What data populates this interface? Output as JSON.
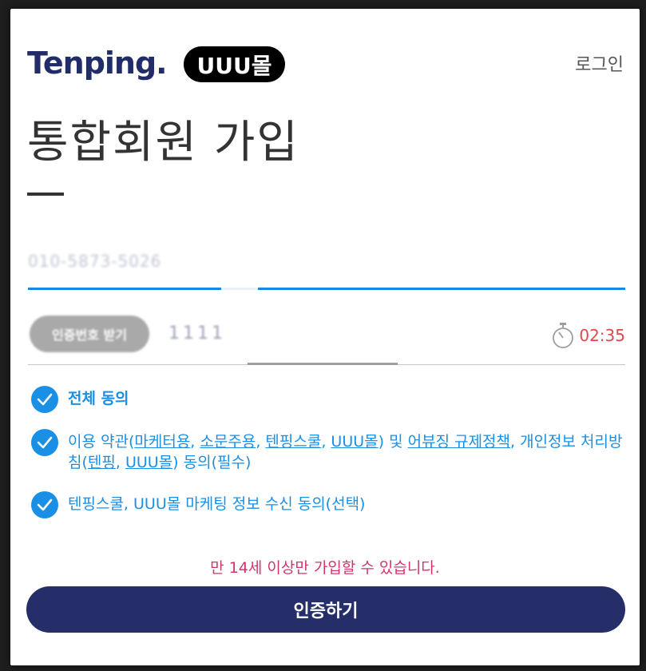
{
  "header": {
    "brand": "Tenping.",
    "mall_badge": "UUU몰",
    "login": "로그인"
  },
  "page": {
    "title": "통합회원 가입"
  },
  "phone": {
    "value": "010-5873-5026"
  },
  "verification": {
    "resend_label": "인증번호 받기",
    "code_value": "1111",
    "timer": "02:35"
  },
  "agreements": {
    "all": "전체 동의",
    "terms": {
      "prefix": "이용 약관(",
      "link_marketer": "마케터용",
      "sep1": ", ",
      "link_influencer": "소문주용",
      "sep2": ", ",
      "link_school": "텐핑스쿨",
      "sep3": ", ",
      "link_mall": "UUU몰",
      "mid": ") 및 ",
      "link_abuse": "어뷰징 규제정책",
      "mid2": ", 개인정보 처리방침(",
      "link_tenping": "텐핑",
      "sep4": ", ",
      "link_mall2": "UUU몰",
      "suffix": ") 동의(필수)"
    },
    "marketing": "텐핑스쿨, UUU몰 마케팅 정보 수신 동의(선택)"
  },
  "notice": "만 14세 이상만 가입할 수 있습니다.",
  "submit_label": "인증하기",
  "colors": {
    "brand": "#222c69",
    "accent": "#1a8fe6",
    "timer": "#e5454f",
    "notice": "#d5336a",
    "button": "#252e69"
  }
}
